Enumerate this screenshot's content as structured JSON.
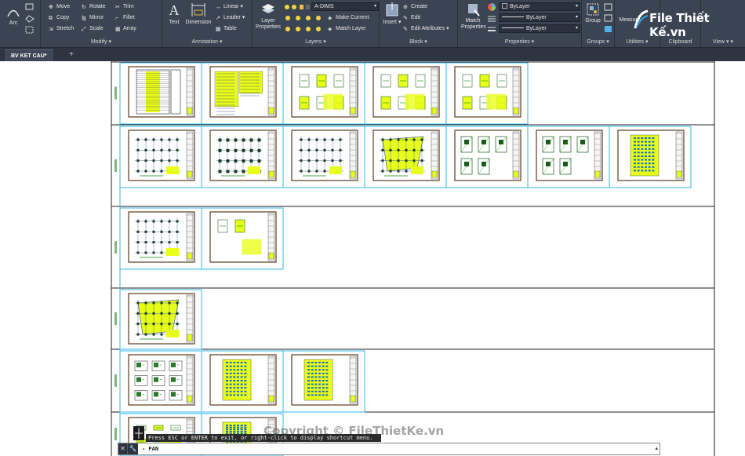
{
  "app": {
    "accent": "#3b4453",
    "canvas_bg": "#ffffff",
    "highlight_color": "#33b6e8",
    "sheet_fill": "#e8ff1a"
  },
  "ribbon": {
    "draw": {
      "arc_label": "Arc"
    },
    "modify": {
      "title": "Modify",
      "move": "Move",
      "rotate": "Rotate",
      "trim": "Trim",
      "copy": "Copy",
      "mirror": "Mirror",
      "fillet": "Fillet",
      "stretch": "Stretch",
      "scale": "Scale",
      "array": "Array"
    },
    "annotation": {
      "title": "Annotation",
      "text": "Text",
      "dimension": "Dimension",
      "linear": "Linear",
      "leader": "Leader",
      "table": "Table"
    },
    "layers": {
      "title": "Layers",
      "layer_properties_line1": "Layer",
      "layer_properties_line2": "Properties",
      "current_layer": "A-DIMS",
      "make_current": "Make Current",
      "match_layer": "Match Layer"
    },
    "block": {
      "title": "Block",
      "insert": "Insert",
      "create": "Create",
      "edit": "Edit",
      "edit_attributes": "Edit Attributes"
    },
    "properties": {
      "title": "Properties",
      "match_line1": "Match",
      "match_line2": "Properties",
      "color": "ByLayer",
      "linetype": "ByLayer",
      "lineweight": "ByLayer"
    },
    "groups": {
      "title": "Groups",
      "group": "Group"
    },
    "utilities": {
      "title": "Utilities",
      "measure": "Measure"
    },
    "clipboard": {
      "title": "Clipboard"
    },
    "view": {
      "title": "View"
    }
  },
  "logo": {
    "text": "File Thiết Kế.vn"
  },
  "tabs": {
    "file_tab": "BV KET CAU*",
    "add_tab": "+"
  },
  "command": {
    "history": "Press ESC or ENTER to exit, or right-click to display shortcut menu.",
    "input": "- PAN",
    "close": "✕",
    "wrench": "🔧",
    "dropdown": "▴"
  },
  "watermark": {
    "text": "Copyright © FileThietKe.vn"
  },
  "drawing": {
    "rows": [
      {
        "sheets": [
          "table",
          "notes",
          "details",
          "details",
          "details"
        ]
      },
      {
        "sheets": [
          "plan",
          "plan-dense",
          "plan",
          "plan-angled",
          "section",
          "section",
          "schedule"
        ]
      },
      {
        "sheets": [
          "plan",
          "detail-single"
        ]
      },
      {
        "sheets": [
          "plan-angled"
        ]
      },
      {
        "sheets": [
          "grid-details",
          "schedule",
          "schedule"
        ]
      },
      {
        "sheets": [
          "details",
          "schedule"
        ]
      }
    ]
  }
}
